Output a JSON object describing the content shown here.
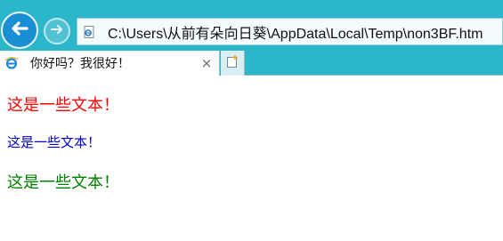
{
  "browser": {
    "address": "C:\\Users\\从前有朵向日葵\\AppData\\Local\\Temp\\non3BF.htm",
    "tab_title": "你好吗？我很好！",
    "tab_close": "×",
    "icons": {
      "back": "back-arrow-icon",
      "forward": "forward-arrow-icon",
      "favicon": "ie-page-icon",
      "tab_icon": "ie-logo-icon",
      "new_tab": "new-tab-icon"
    },
    "colors": {
      "chrome": "#2bb7c9",
      "back_button": "#1b8fd4"
    }
  },
  "page": {
    "lines": [
      {
        "text": "这是一些文本！",
        "color": "#ff0000"
      },
      {
        "text": "这是一些文本！",
        "color": "#0000cc"
      },
      {
        "text": "这是一些文本！",
        "color": "#008000"
      }
    ]
  }
}
